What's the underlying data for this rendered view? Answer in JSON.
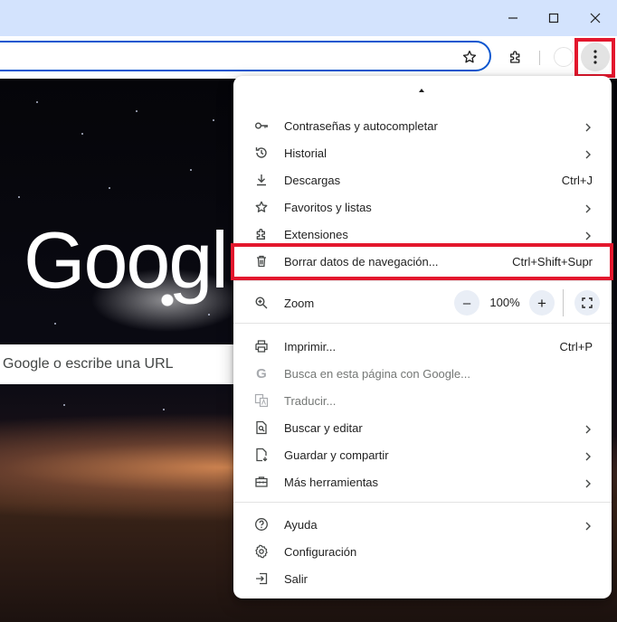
{
  "window": {
    "controls": [
      "minimize-icon",
      "maximize-icon",
      "close-icon"
    ]
  },
  "toolbar": {
    "icons": [
      "star-icon",
      "extensions-icon",
      "profile-icon",
      "more-vert-icon"
    ]
  },
  "page": {
    "logo_text": "Googl",
    "search_placeholder": "Google o escribe una URL"
  },
  "menu": {
    "items": [
      {
        "label": "Contraseñas y autocompletar",
        "icon": "key-icon",
        "submenu": true
      },
      {
        "label": "Historial",
        "icon": "history-icon",
        "submenu": true
      },
      {
        "label": "Descargas",
        "icon": "download-icon",
        "shortcut": "Ctrl+J"
      },
      {
        "label": "Favoritos y listas",
        "icon": "star-icon",
        "submenu": true
      },
      {
        "label": "Extensiones",
        "icon": "extensions-icon",
        "submenu": true
      },
      {
        "label": "Borrar datos de navegación...",
        "icon": "trash-icon",
        "shortcut": "Ctrl+Shift+Supr"
      }
    ],
    "zoom": {
      "label": "Zoom",
      "value": "100%",
      "minus": "–",
      "plus": "+"
    },
    "items2": [
      {
        "label": "Imprimir...",
        "icon": "print-icon",
        "shortcut": "Ctrl+P"
      },
      {
        "label": "Busca en esta página con Google...",
        "icon": "google-g-icon",
        "disabled": true
      },
      {
        "label": "Traducir...",
        "icon": "translate-icon",
        "disabled": true
      },
      {
        "label": "Buscar y editar",
        "icon": "find-page-icon",
        "submenu": true
      },
      {
        "label": "Guardar y compartir",
        "icon": "save-file-icon",
        "submenu": true
      },
      {
        "label": "Más herramientas",
        "icon": "toolbox-icon",
        "submenu": true
      }
    ],
    "items3": [
      {
        "label": "Ayuda",
        "icon": "help-icon",
        "submenu": true
      },
      {
        "label": "Configuración",
        "icon": "settings-icon"
      },
      {
        "label": "Salir",
        "icon": "exit-icon"
      }
    ]
  },
  "colors": {
    "highlight": "#e3172d",
    "titlebar": "#d3e3fd",
    "omnibox_border": "#0b57d0"
  }
}
